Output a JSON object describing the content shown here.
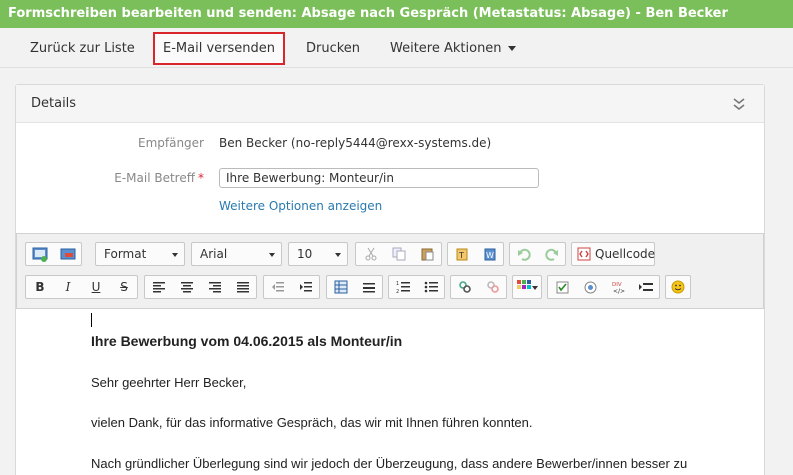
{
  "window": {
    "title": "Formschreiben bearbeiten und senden: Absage nach Gespräch (Metastatus: Absage) - Ben Becker"
  },
  "toolbar": {
    "back_label": "Zurück zur Liste",
    "send_label": "E-Mail versenden",
    "print_label": "Drucken",
    "more_label": "Weitere Aktionen"
  },
  "details": {
    "title": "Details",
    "recipient_label": "Empfänger",
    "recipient_value": "Ben Becker (no-reply5444@rexx-systems.de)",
    "subject_label": "E-Mail Betreff",
    "subject_required": "*",
    "subject_value": "Ihre Bewerbung: Monteur/in",
    "more_options_label": "Weitere Optionen anzeigen"
  },
  "editor": {
    "format_label": "Format",
    "font_label": "Arial",
    "size_label": "10",
    "source_label": "Quellcode",
    "heading": "Ihre Bewerbung vom 04.06.2015 als Monteur/in",
    "salutation": "Sehr geehrter Herr Becker,",
    "para1": "vielen Dank, für das informative Gespräch, das wir mit Ihnen führen konnten.",
    "para2": "Nach gründlicher Überlegung sind wir jedoch der Überzeugung, dass andere Bewerber/innen besser zu"
  },
  "icons": {
    "accent": "#7bbf5a",
    "highlight_border": "#d9262c",
    "link": "#2a7ab0"
  }
}
